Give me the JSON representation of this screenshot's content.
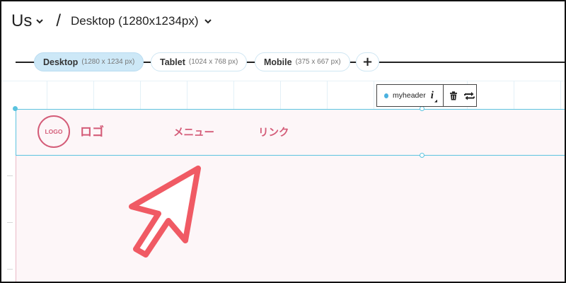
{
  "topbar": {
    "site_name": "Us",
    "separator": "/",
    "page_name": "Desktop (1280x1234px)"
  },
  "breakpoints": [
    {
      "name": "Desktop",
      "dims": "(1280 x 1234 px)",
      "active": true
    },
    {
      "name": "Tablet",
      "dims": "(1024 x 768 px)",
      "active": false
    },
    {
      "name": "Mobile",
      "dims": "(375 x 667 px)",
      "active": false
    }
  ],
  "add_breakpoint_label": "+",
  "element_toolbar": {
    "element_name": "myheader",
    "info_label": "i"
  },
  "header_block": {
    "logo_badge": "LOGO",
    "logo_text": "ロゴ",
    "menu_text": "メニュー",
    "link_text": "リンク"
  },
  "colors": {
    "accent_blue": "#5bc3df",
    "brand_pink": "#d45c78",
    "arrow_red": "#f05a64",
    "active_pill": "#cde8f7"
  },
  "icons": {
    "trash": "trash-icon",
    "swap": "swap-icon",
    "chevron": "chevron-down-icon",
    "cursor": "pointer-arrow-icon"
  }
}
